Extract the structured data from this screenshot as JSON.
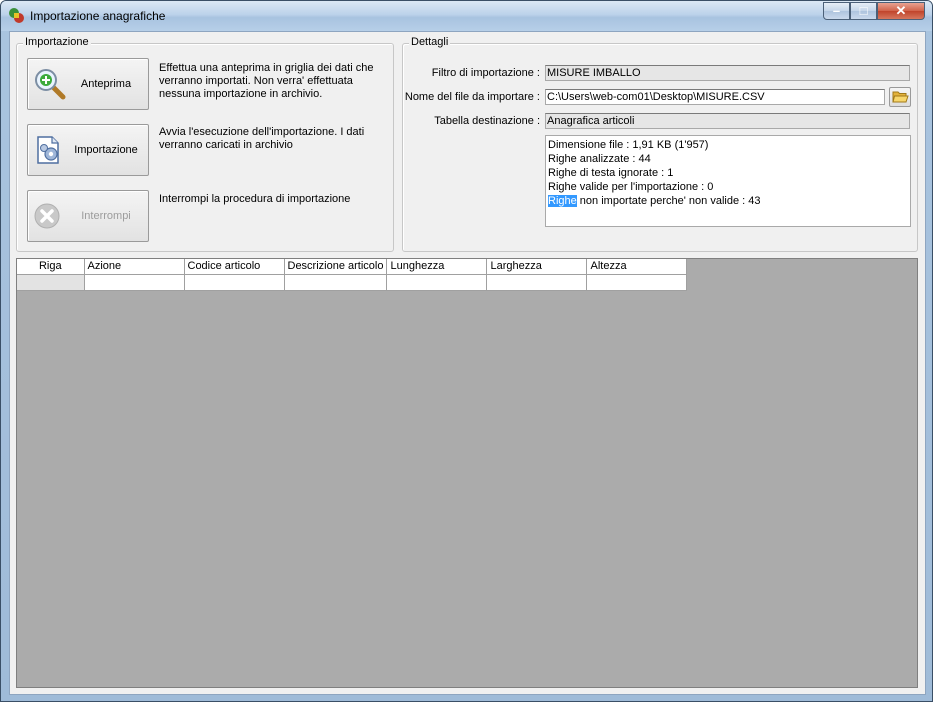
{
  "window": {
    "title": "Importazione anagrafiche",
    "controls": {
      "minimize": "–",
      "maximize": "□",
      "close": "✕"
    }
  },
  "import_group": {
    "legend": "Importazione",
    "buttons": [
      {
        "label": "Anteprima",
        "icon": "magnifier-plus-icon",
        "enabled": true,
        "description": "Effettua una anteprima in griglia dei dati che verranno importati. Non verra' effettuata nessuna importazione in archivio."
      },
      {
        "label": "Importazione",
        "icon": "document-gears-icon",
        "enabled": true,
        "description": "Avvia l'esecuzione dell'importazione. I dati verranno caricati in archivio"
      },
      {
        "label": "Interrompi",
        "icon": "stop-x-icon",
        "enabled": false,
        "description": "Interrompi la procedura di importazione"
      }
    ]
  },
  "details_group": {
    "legend": "Dettagli",
    "filter_label": "Filtro di importazione :",
    "filter_value": "MISURE IMBALLO",
    "file_label": "Nome del file da importare :",
    "file_value": "C:\\Users\\web-com01\\Desktop\\MISURE.CSV",
    "browse_icon": "folder-open-icon",
    "table_label": "Tabella destinazione :",
    "table_value": "Anagrafica articoli",
    "log_lines": [
      "Dimensione file : 1,91 KB (1'957)",
      "Righe analizzate : 44",
      "Righe di testa ignorate : 1",
      "Righe valide per l'importazione : 0"
    ],
    "log_last_selected": "Righe",
    "log_last_rest": " non importate perche' non valide : 43"
  },
  "grid": {
    "columns": [
      "Riga",
      "Azione",
      "Codice articolo",
      "Descrizione articolo",
      "Lunghezza",
      "Larghezza",
      "Altezza"
    ]
  },
  "colors": {
    "selection": "#3399ff",
    "grid_background": "#ababab",
    "window_frame": "#a9c4df"
  }
}
